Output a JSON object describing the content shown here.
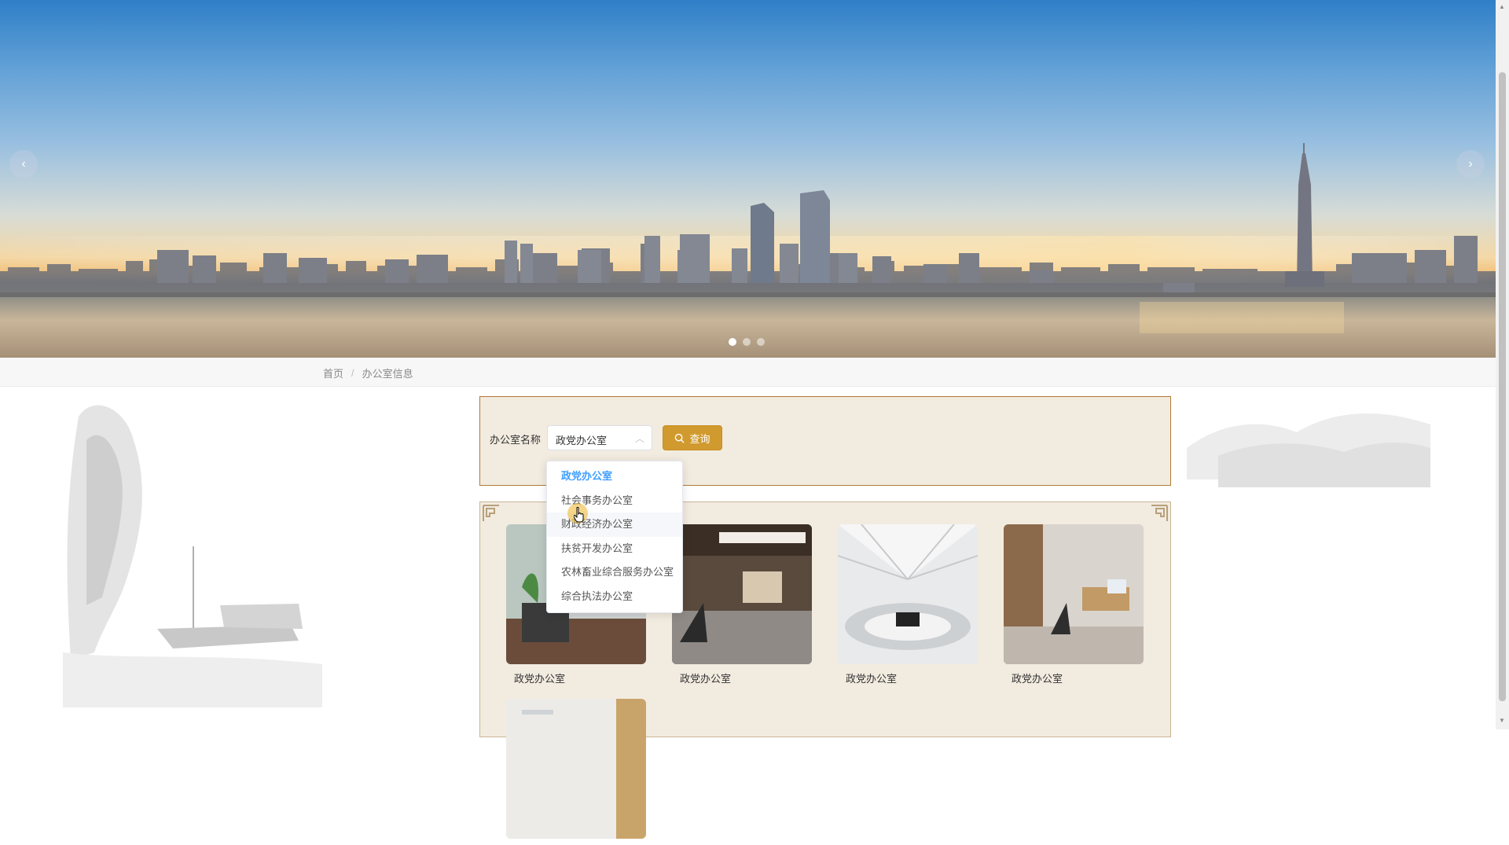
{
  "carousel": {
    "prev_icon": "‹",
    "next_icon": "›",
    "slide_count": 3,
    "active_index": 0
  },
  "breadcrumb": {
    "home": "首页",
    "separator": "/",
    "current": "办公室信息"
  },
  "search": {
    "label": "办公室名称",
    "selected_value": "政党办公室",
    "button_label": "查询",
    "button_icon": "search-icon"
  },
  "dropdown": {
    "options": [
      "政党办公室",
      "社会事务办公室",
      "财政经济办公室",
      "扶贫开发办公室",
      "农林畜业综合服务办公室",
      "综合执法办公室"
    ],
    "selected_index": 0,
    "hover_index": 2
  },
  "offices": [
    {
      "name": "政党办公室"
    },
    {
      "name": "政党办公室"
    },
    {
      "name": "政党办公室"
    },
    {
      "name": "政党办公室"
    },
    {
      "name": ""
    }
  ],
  "colors": {
    "accent": "#d19a2e",
    "panel_bg": "#f2ebe0",
    "selected_option": "#409eff"
  }
}
